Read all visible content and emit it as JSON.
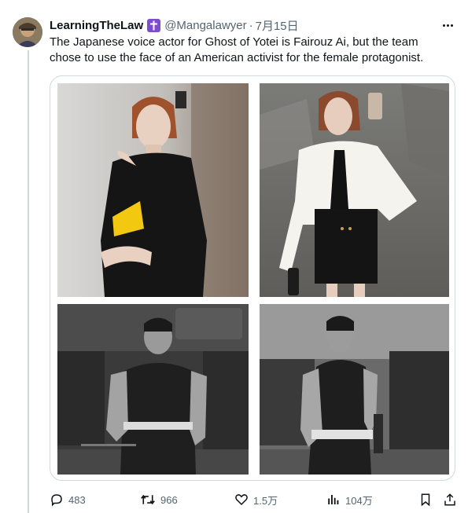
{
  "tweet": {
    "display_name": "LearningTheLaw",
    "handle": "@Mangalawyer",
    "separator": "·",
    "date": "7月15日",
    "text": "The Japanese voice actor for Ghost of Yotei is Fairouz Ai, but the team chose to use the face of an American activist for the female protagonist."
  },
  "media": [
    {
      "name": "photo-woman-black-outfit",
      "description_icon": "photo"
    },
    {
      "name": "photo-woman-mirror-selfie",
      "description_icon": "photo"
    },
    {
      "name": "photo-woman-grayscale-gym-1",
      "description_icon": "photo"
    },
    {
      "name": "photo-woman-grayscale-gym-2",
      "description_icon": "photo"
    }
  ],
  "actions": {
    "reply_count": "483",
    "retweet_count": "966",
    "like_count": "1.5万",
    "view_count": "104万"
  },
  "icons": {
    "badge": "cross-badge-icon",
    "more": "more-icon",
    "reply": "reply-icon",
    "retweet": "retweet-icon",
    "like": "heart-icon",
    "views": "views-icon",
    "bookmark": "bookmark-icon",
    "share": "share-icon"
  },
  "colors": {
    "text": "#0f1419",
    "secondary": "#536471",
    "border": "#cfd9de",
    "badge": "#7e4ccf"
  }
}
